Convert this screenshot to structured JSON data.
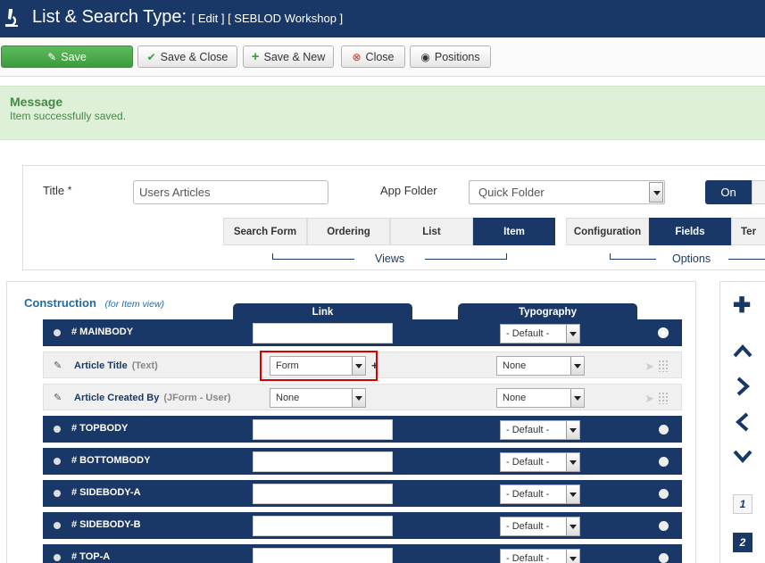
{
  "header": {
    "title": "List & Search Type:",
    "subtitle": "[ Edit ] [ SEBLOD Workshop ]"
  },
  "toolbar": {
    "save": "Save",
    "save_close": "Save & Close",
    "save_new": "Save & New",
    "close": "Close",
    "positions": "Positions"
  },
  "message": {
    "title": "Message",
    "text": "Item successfully saved."
  },
  "form": {
    "title_label": "Title",
    "required_mark": "*",
    "title_value": "Users Articles",
    "app_folder_label": "App Folder",
    "app_folder_value": "Quick Folder",
    "toggle_on": "On"
  },
  "views_tabs": [
    "Search Form",
    "Ordering",
    "List",
    "Item"
  ],
  "views_active": "Item",
  "views_label": "Views",
  "options_tabs": [
    "Configuration",
    "Fields",
    "Ter"
  ],
  "options_active": "Fields",
  "options_label": "Options",
  "construction": {
    "title": "Construction",
    "subtitle": "(for Item view)",
    "col_link": "Link",
    "col_typography": "Typography"
  },
  "rows": [
    {
      "type": "position",
      "label": "# MAINBODY",
      "typo": "- Default -"
    },
    {
      "type": "field",
      "label": "Article Title",
      "ftype": "(Text)",
      "link": "Form",
      "typo": "None"
    },
    {
      "type": "field",
      "label": "Article Created By",
      "ftype": "(JForm - User)",
      "link": "None",
      "typo": "None"
    },
    {
      "type": "position",
      "label": "# TOPBODY",
      "typo": "- Default -"
    },
    {
      "type": "position",
      "label": "# BOTTOMBODY",
      "typo": "- Default -"
    },
    {
      "type": "position",
      "label": "# SIDEBODY-A",
      "typo": "- Default -"
    },
    {
      "type": "position",
      "label": "# SIDEBODY-B",
      "typo": "- Default -"
    },
    {
      "type": "position",
      "label": "# TOP-A",
      "typo": "- Default -"
    }
  ],
  "right_panel": {
    "numbers": [
      "1",
      "2"
    ]
  },
  "colors": {
    "brand_navy": "#1a3867",
    "success_green": "#468847",
    "save_green": "#4cae4c",
    "highlight_red": "#d60000"
  }
}
